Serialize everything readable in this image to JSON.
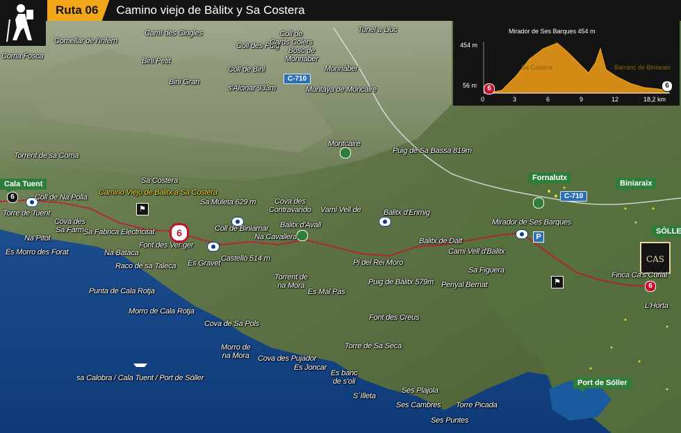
{
  "header": {
    "route_label": "Ruta 06",
    "title": "Camino viejo de Bàlitx y Sa Costera"
  },
  "icons": {
    "hiker": "hiker-icon",
    "viewpoint": "eye-icon",
    "hut": "hiker-sign-icon"
  },
  "colors": {
    "route": "#c8102e",
    "accent": "#f3a81c",
    "town": "#2e7d3b",
    "road": "#2f6fb3",
    "profile_fill": "#d38a16"
  },
  "profile": {
    "summit": "Mirador de Ses Barques 454 m",
    "y_top": "454 m",
    "y_bottom": "56 m",
    "x_ticks": [
      "0",
      "3",
      "6",
      "9",
      "12",
      "18,2 km"
    ],
    "start_marker": "6",
    "end_marker": "6",
    "ghost_labels": [
      "Sa Costera",
      "Barranc de Biniaraix"
    ]
  },
  "roads": {
    "c710_north": "C-710",
    "c710_east": "C-710"
  },
  "towns": {
    "cala_tuent": "Cala Tuent",
    "fornalutx": "Fornalutx",
    "biniaraix": "Biniaraix",
    "soller": "SÓLLER",
    "port_soller": "Port de Sóller"
  },
  "markers": {
    "start_big": "6",
    "cala_tuent_six": "6",
    "finca_six": "6",
    "finca_logo": "CAS",
    "parking": "P"
  },
  "labels": {
    "coma_fosca": "Coma Fosca",
    "comellar_infern": "Comellar de l'Infern",
    "cami_cingles": "Camí des Cingles",
    "coll_puig": "Coll des Puig",
    "coll_cards": "Coll de\nCards Colers",
    "bosc_monnaber": "Bosc de\nMonnàber",
    "tunel_lluc": "Tunel a Lluc",
    "bini_petit": "Bini Petit",
    "coll_bini": "Coll de Bini",
    "monnaber": "Monnàber",
    "bini_gran": "Bini Gran",
    "salcinar": "s'Alcinar 933m",
    "muntaya": "Muntaya de Moncaire",
    "montcaire": "Montcaire",
    "puig_bassa": "Puig de Sa Bassa 819m",
    "torrent_coma": "Torrent de sa Coma",
    "sa_costera": "Sa Costera",
    "camino_viejo": "Camino Viejo de Balitx a Sa Costera",
    "coll_na_polla": "Coll de Na Polla",
    "torre_tuent": "Torre de Tuent",
    "sa_muleta": "Sa Muleta 629 m",
    "cova_contravando": "Cova des\nContravando",
    "vami_vell": "Vami Vell de",
    "balitx_enmig": "Balitx d'Enmig",
    "cova_farm": "Cova des\nSa Farm",
    "sa_fabrica": "Sa Fabrica Electricitat",
    "coll_biniamar": "Coll de Biniamar",
    "balitx_avall": "Balitx d'Avall",
    "na_cavallera": "Na Cavallera",
    "mirador_barques": "Mirador de Ses Barques",
    "na_pitot": "Na Pitot",
    "font_verger": "Font des Ver ger",
    "balitx_dalt": "Balitx de Dalt",
    "cami_vell": "Cami Vell d'Balitx",
    "es_morro_forat": "Es Morro des Forat",
    "na_bataca": "Na Bataca",
    "castello": "Castelló 514 m",
    "pi_rei_moro": "Pi del Rei Moro",
    "raco_taleca": "Raco de sa Taleca",
    "es_gravet": "Es Gravet",
    "sa_figuera": "Sa Figuera",
    "finca_cas_curial": "Finca Ca's Curial",
    "torrent_na_mora": "Torrent de\nna Mora",
    "puig_balitx": "Puig de Bàlitx 579m",
    "penyal_bernat": "Penyal Bernat",
    "punta_cala_rotja": "Punta de Cala Rotja",
    "es_mal_pas": "Es Mal Pas",
    "morro_cala_rotja": "Morro de Cala Rotja",
    "lhorta": "L'Horta",
    "font_creus": "Font des Creus",
    "cova_sa_pols": "Cova de Sa Pols",
    "torre_sa_seca": "Torre de Sa Seca",
    "morro_na_mora": "Morro de\nna Mora",
    "cova_pujador": "Cova des Pujador",
    "es_joncar": "Es Joncar",
    "es_banc_soli": "Es banc\nde s'oli",
    "sa_calobra": "sa Calobra / Cala Tuent / Port de Sóller",
    "s_illeta": "S´Illeta",
    "sa_plajola": "Ses Plajola",
    "ses_cambres": "Ses Cambres",
    "torre_picada": "Torre Picada",
    "ses_puntes": "Ses Puntes"
  }
}
